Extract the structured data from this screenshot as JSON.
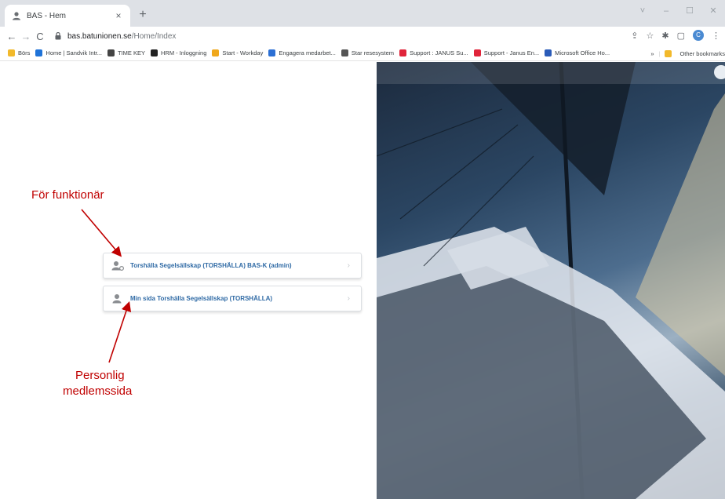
{
  "browser": {
    "tab_title": "BAS - Hem",
    "tab_close": "×",
    "new_tab": "+",
    "window_controls": {
      "collapse": "˅",
      "minimize": "–",
      "maximize": "☐",
      "close": "✕"
    },
    "url_host": "bas.batunionen.se",
    "url_path": "/Home/Index",
    "profile_initial": "C",
    "bookmarks": [
      {
        "label": "Börs",
        "color": "#f2b92b"
      },
      {
        "label": "Home | Sandvik Intr...",
        "color": "#1f73d8"
      },
      {
        "label": "TIME KEY",
        "color": "#444444"
      },
      {
        "label": "HRM - Inloggning",
        "color": "#222222"
      },
      {
        "label": "Start - Workday",
        "color": "#f0a81c"
      },
      {
        "label": "Engagera medarbet...",
        "color": "#2b6fd4"
      },
      {
        "label": "Star resesystem",
        "color": "#555555"
      },
      {
        "label": "Support : JANUS Su...",
        "color": "#e0243a"
      },
      {
        "label": "Support - Janus En...",
        "color": "#e0243a"
      },
      {
        "label": "Microsoft Office Ho...",
        "color": "#2a5bb8"
      }
    ],
    "bookmarks_overflow": "»",
    "other_bookmarks": "Other bookmarks"
  },
  "page": {
    "cards": [
      {
        "label": "Torshälla Segelsällskap (TORSHÄLLA) BAS-K (admin)",
        "icon": "user-admin-icon",
        "chevron": "›"
      },
      {
        "label": "Min sida Torshälla Segelsällskap (TORSHÄLLA)",
        "icon": "user-icon",
        "chevron": "›"
      }
    ],
    "annotations": {
      "officials": "För funktionär",
      "personal_line1": "Personlig",
      "personal_line2": "medlemssida"
    },
    "colors": {
      "link": "#2f6aa5",
      "annotation": "#c00000"
    }
  }
}
